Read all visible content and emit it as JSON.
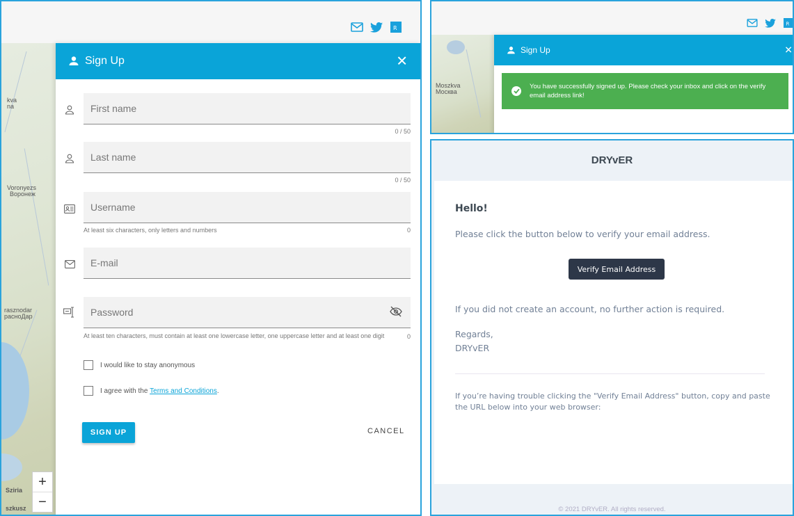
{
  "left": {
    "map_labels": {
      "kva": "kva",
      "na": "na",
      "voronezh": "Voronyezs",
      "voronezh_cyr": "Воронеж",
      "krasnodar": "rasznodar",
      "krasnodar_cyr": "расноДар",
      "sziria": "Sziria",
      "szkus": "szkusz"
    },
    "modal": {
      "title": "Sign Up",
      "fields": [
        {
          "placeholder": "First name",
          "counter": "0 / 50"
        },
        {
          "placeholder": "Last name",
          "counter": "0 / 50"
        },
        {
          "placeholder": "Username",
          "hint": "At least six characters, only letters and numbers",
          "counter": "0"
        },
        {
          "placeholder": "E-mail"
        },
        {
          "placeholder": "Password",
          "hint": "At least ten characters, must contain at least one lowercase letter, one uppercase letter and at least one digit",
          "counter": "0"
        }
      ],
      "anonymous_label": "I would like to stay anonymous",
      "agree_prefix": "I agree with the ",
      "terms_link": "Terms and Conditions",
      "agree_suffix": ".",
      "signup_button": "SIGN UP",
      "cancel_button": "CANCEL"
    },
    "zoom": {
      "in": "+",
      "out": "−"
    }
  },
  "topright": {
    "map_labels": {
      "moszkva": "Moszkva",
      "moskva_cyr": "Москва"
    },
    "modal_title": "Sign Up",
    "success_message": "You have successfully signed up. Please check your inbox and click on the verify email address link!"
  },
  "email": {
    "brand": "DRYvER",
    "greeting": "Hello!",
    "intro": "Please click the button below to verify your email address.",
    "button": "Verify Email Address",
    "no_action": "If you did not create an account, no further action is required.",
    "regards": "Regards,",
    "signature": "DRYvER",
    "trouble": "If you’re having trouble clicking the \"Verify Email Address\" button, copy and paste the URL below into your web browser:",
    "footer": "© 2021 DRYvER. All rights reserved."
  },
  "colors": {
    "accent": "#0aa4d8",
    "success": "#4caf50",
    "button_dark": "#2d3748"
  }
}
